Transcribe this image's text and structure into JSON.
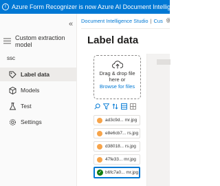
{
  "banner": {
    "text": "Azure Form Recognizer is now Azure AI Document Intelligence. Learn m",
    "icon": "info-icon"
  },
  "sidebar": {
    "collapse_glyph": "«",
    "header": "Custom extraction model",
    "project": "ssc",
    "items": [
      {
        "label": "Label data",
        "icon": "label-icon",
        "active": true
      },
      {
        "label": "Models",
        "icon": "cube-icon",
        "active": false
      },
      {
        "label": "Test",
        "icon": "flask-icon",
        "active": false
      },
      {
        "label": "Settings",
        "icon": "gear-icon",
        "active": false
      }
    ]
  },
  "breadcrumb": {
    "root": "Document Intelligence Studio",
    "separator": "|",
    "current": "Cus"
  },
  "page": {
    "title": "Label data"
  },
  "dropzone": {
    "line1": "Drag & drop file",
    "line2": "here or",
    "browse": "Browse for files"
  },
  "files": [
    {
      "name": "ad3c9d... mr.jpg",
      "status": "pending"
    },
    {
      "name": "e8e6cb7... rs.jpg",
      "status": "pending"
    },
    {
      "name": "d38018... rs.jpg",
      "status": "pending"
    },
    {
      "name": "47fe33... mr.jpg",
      "status": "pending"
    },
    {
      "name": "b6fc7a0... mr.jpg",
      "status": "labeled"
    }
  ],
  "colors": {
    "accent": "#0078d4",
    "pending": "#f7a44a",
    "labeled": "#107c10"
  }
}
